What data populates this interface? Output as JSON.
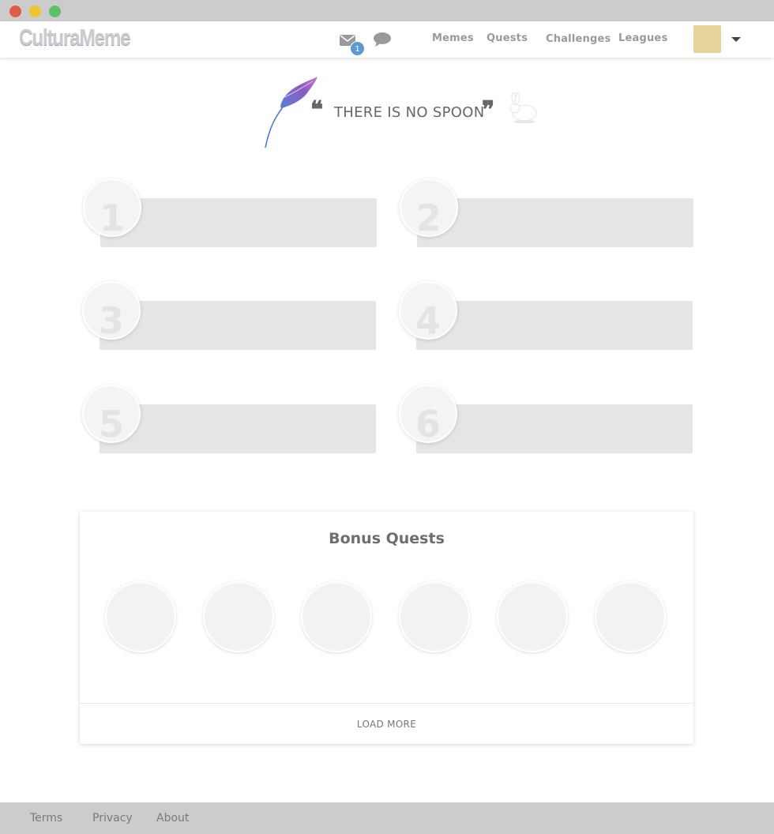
{
  "window": {
    "controls": {
      "close_color": "#e15a4b",
      "minimize_color": "#f1c232",
      "maximize_color": "#5cc16a"
    }
  },
  "header": {
    "logo": "CulturaMeme",
    "icons": {
      "messages": "mail-icon",
      "chat": "chat-icon"
    },
    "message_badge": "1",
    "badge_color": "#5a9bd5",
    "nav": [
      {
        "label": "Memes"
      },
      {
        "label": "Quests"
      },
      {
        "label": "Challenges"
      },
      {
        "label": "Leagues"
      }
    ],
    "avatar_color": "#e4d49a"
  },
  "quote": {
    "text": "THERE IS NO SPOON",
    "open_mark": "❝",
    "close_mark": "❞",
    "icons": {
      "left": "feather-icon",
      "right": "rabbit-icon"
    }
  },
  "quest_slots": [
    {
      "number": "1"
    },
    {
      "number": "2"
    },
    {
      "number": "3"
    },
    {
      "number": "4"
    },
    {
      "number": "5"
    },
    {
      "number": "6"
    }
  ],
  "bonus": {
    "title": "Bonus Quests",
    "load_more": "LOAD MORE"
  },
  "footer": {
    "links": [
      {
        "label": "Terms"
      },
      {
        "label": "Privacy"
      },
      {
        "label": "About"
      }
    ]
  }
}
